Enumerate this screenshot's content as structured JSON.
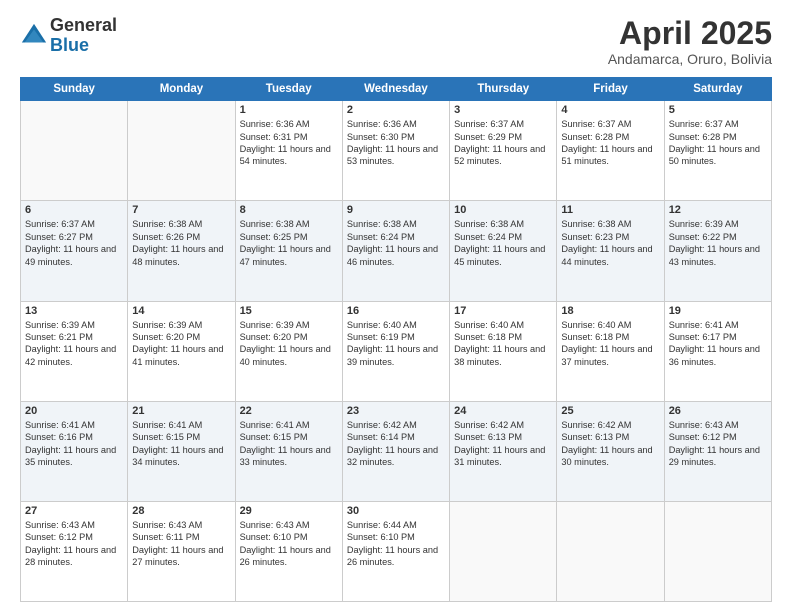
{
  "logo": {
    "general": "General",
    "blue": "Blue"
  },
  "title": "April 2025",
  "subtitle": "Andamarca, Oruro, Bolivia",
  "days": [
    "Sunday",
    "Monday",
    "Tuesday",
    "Wednesday",
    "Thursday",
    "Friday",
    "Saturday"
  ],
  "weeks": [
    [
      {
        "day": "",
        "content": ""
      },
      {
        "day": "",
        "content": ""
      },
      {
        "day": "1",
        "content": "Sunrise: 6:36 AM\nSunset: 6:31 PM\nDaylight: 11 hours and 54 minutes."
      },
      {
        "day": "2",
        "content": "Sunrise: 6:36 AM\nSunset: 6:30 PM\nDaylight: 11 hours and 53 minutes."
      },
      {
        "day": "3",
        "content": "Sunrise: 6:37 AM\nSunset: 6:29 PM\nDaylight: 11 hours and 52 minutes."
      },
      {
        "day": "4",
        "content": "Sunrise: 6:37 AM\nSunset: 6:28 PM\nDaylight: 11 hours and 51 minutes."
      },
      {
        "day": "5",
        "content": "Sunrise: 6:37 AM\nSunset: 6:28 PM\nDaylight: 11 hours and 50 minutes."
      }
    ],
    [
      {
        "day": "6",
        "content": "Sunrise: 6:37 AM\nSunset: 6:27 PM\nDaylight: 11 hours and 49 minutes."
      },
      {
        "day": "7",
        "content": "Sunrise: 6:38 AM\nSunset: 6:26 PM\nDaylight: 11 hours and 48 minutes."
      },
      {
        "day": "8",
        "content": "Sunrise: 6:38 AM\nSunset: 6:25 PM\nDaylight: 11 hours and 47 minutes."
      },
      {
        "day": "9",
        "content": "Sunrise: 6:38 AM\nSunset: 6:24 PM\nDaylight: 11 hours and 46 minutes."
      },
      {
        "day": "10",
        "content": "Sunrise: 6:38 AM\nSunset: 6:24 PM\nDaylight: 11 hours and 45 minutes."
      },
      {
        "day": "11",
        "content": "Sunrise: 6:38 AM\nSunset: 6:23 PM\nDaylight: 11 hours and 44 minutes."
      },
      {
        "day": "12",
        "content": "Sunrise: 6:39 AM\nSunset: 6:22 PM\nDaylight: 11 hours and 43 minutes."
      }
    ],
    [
      {
        "day": "13",
        "content": "Sunrise: 6:39 AM\nSunset: 6:21 PM\nDaylight: 11 hours and 42 minutes."
      },
      {
        "day": "14",
        "content": "Sunrise: 6:39 AM\nSunset: 6:20 PM\nDaylight: 11 hours and 41 minutes."
      },
      {
        "day": "15",
        "content": "Sunrise: 6:39 AM\nSunset: 6:20 PM\nDaylight: 11 hours and 40 minutes."
      },
      {
        "day": "16",
        "content": "Sunrise: 6:40 AM\nSunset: 6:19 PM\nDaylight: 11 hours and 39 minutes."
      },
      {
        "day": "17",
        "content": "Sunrise: 6:40 AM\nSunset: 6:18 PM\nDaylight: 11 hours and 38 minutes."
      },
      {
        "day": "18",
        "content": "Sunrise: 6:40 AM\nSunset: 6:18 PM\nDaylight: 11 hours and 37 minutes."
      },
      {
        "day": "19",
        "content": "Sunrise: 6:41 AM\nSunset: 6:17 PM\nDaylight: 11 hours and 36 minutes."
      }
    ],
    [
      {
        "day": "20",
        "content": "Sunrise: 6:41 AM\nSunset: 6:16 PM\nDaylight: 11 hours and 35 minutes."
      },
      {
        "day": "21",
        "content": "Sunrise: 6:41 AM\nSunset: 6:15 PM\nDaylight: 11 hours and 34 minutes."
      },
      {
        "day": "22",
        "content": "Sunrise: 6:41 AM\nSunset: 6:15 PM\nDaylight: 11 hours and 33 minutes."
      },
      {
        "day": "23",
        "content": "Sunrise: 6:42 AM\nSunset: 6:14 PM\nDaylight: 11 hours and 32 minutes."
      },
      {
        "day": "24",
        "content": "Sunrise: 6:42 AM\nSunset: 6:13 PM\nDaylight: 11 hours and 31 minutes."
      },
      {
        "day": "25",
        "content": "Sunrise: 6:42 AM\nSunset: 6:13 PM\nDaylight: 11 hours and 30 minutes."
      },
      {
        "day": "26",
        "content": "Sunrise: 6:43 AM\nSunset: 6:12 PM\nDaylight: 11 hours and 29 minutes."
      }
    ],
    [
      {
        "day": "27",
        "content": "Sunrise: 6:43 AM\nSunset: 6:12 PM\nDaylight: 11 hours and 28 minutes."
      },
      {
        "day": "28",
        "content": "Sunrise: 6:43 AM\nSunset: 6:11 PM\nDaylight: 11 hours and 27 minutes."
      },
      {
        "day": "29",
        "content": "Sunrise: 6:43 AM\nSunset: 6:10 PM\nDaylight: 11 hours and 26 minutes."
      },
      {
        "day": "30",
        "content": "Sunrise: 6:44 AM\nSunset: 6:10 PM\nDaylight: 11 hours and 26 minutes."
      },
      {
        "day": "",
        "content": ""
      },
      {
        "day": "",
        "content": ""
      },
      {
        "day": "",
        "content": ""
      }
    ]
  ]
}
